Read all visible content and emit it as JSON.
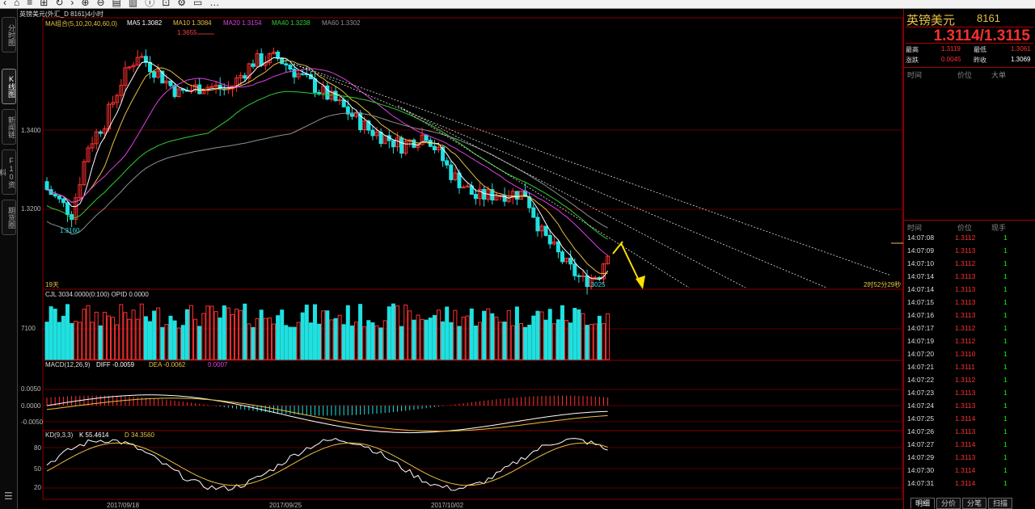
{
  "toolbar": {
    "icons": [
      "back-icon",
      "home-icon",
      "list-icon",
      "grid-icon",
      "refresh-icon",
      "forward-icon",
      "zoom-in-icon",
      "zoom-out-icon",
      "chart-icon",
      "bar-icon",
      "info-icon",
      "lock-icon",
      "tools-icon",
      "window-icon",
      "more-icon"
    ],
    "icon_glyphs": [
      "‹",
      "⌂",
      "≡",
      "⊞",
      "↻",
      "›",
      "⊕",
      "⊖",
      "▤",
      "▥",
      "ⓘ",
      "⊡",
      "⚙",
      "▭",
      "…"
    ],
    "right_items": [
      "",
      "",
      "",
      "",
      ""
    ]
  },
  "left_tabs": [
    {
      "label": "分时图"
    },
    {
      "label": "K线图"
    },
    {
      "label": "新闻链"
    },
    {
      "label": "F10资料"
    },
    {
      "label": "期货圈"
    }
  ],
  "chart": {
    "title": "英镑美元(外汇_D 8161)4小时",
    "ma_legend": [
      {
        "label": "MA组合(5,10,20,40,60,0)",
        "color": "#e8c040"
      },
      {
        "label": "MA5 1.3082",
        "color": "#ffffff"
      },
      {
        "label": "MA10 1.3084",
        "color": "#e8c040"
      },
      {
        "label": "MA20 1.3154",
        "color": "#e040e0"
      },
      {
        "label": "MA40 1.3238",
        "color": "#30d030"
      },
      {
        "label": "MA60 1.3302",
        "color": "#909090"
      }
    ],
    "high_marker": "1.3655",
    "low_marker_left": "1.3160",
    "low_marker_right": "1.3025",
    "bars_label": "19天",
    "countdown": "2时52分29秒",
    "price_axis": [
      "1.3400",
      "1.3200"
    ],
    "volume": {
      "label": "CJL  3034.0000(0:100)   OPID  0.0000",
      "axis": "7100"
    },
    "macd": {
      "label": "MACD(12,26,9)",
      "diff": "DIFF  -0.0059",
      "dea": "DEA  -0.0062",
      "macd": "0.0007",
      "axis": [
        "0.0050",
        "0.0000",
        "-0.0050"
      ]
    },
    "kd": {
      "label": "KD(9,3,3)",
      "k": "K  55.4614",
      "d": "D  34.3560",
      "axis": [
        "80",
        "50",
        "20"
      ]
    },
    "dates": [
      "2017/09/18",
      "2017/09/25",
      "2017/10/02"
    ]
  },
  "chart_data": {
    "type": "candlestick",
    "price_range": [
      1.302,
      1.37
    ],
    "colors": {
      "up": "#ff3030",
      "down": "#20e0e0",
      "ma5": "#ffffff",
      "ma10": "#e8c040",
      "ma20": "#e040e0",
      "ma40": "#30d030",
      "ma60": "#909090"
    }
  },
  "right_panel": {
    "name": "英镑美元",
    "code": "8161",
    "bid_ask": "1.3114/1.3115",
    "stats": [
      {
        "label": "最高",
        "value": "1.3119",
        "label2": "最低",
        "value2": "1.3061"
      },
      {
        "label": "涨跌",
        "value": "0.0045",
        "label2": "昨收",
        "value2": "1.3069"
      }
    ],
    "upper_header": {
      "time": "时间",
      "price": "价位",
      "vol": "大单"
    },
    "lower_header": {
      "time": "时间",
      "price": "价位",
      "vol": "现手"
    },
    "ticks": [
      {
        "time": "14:07:08",
        "price": "1.3112",
        "vol": "1"
      },
      {
        "time": "14:07:09",
        "price": "1.3113",
        "vol": "1"
      },
      {
        "time": "14:07:10",
        "price": "1.3112",
        "vol": "1"
      },
      {
        "time": "14:07:14",
        "price": "1.3113",
        "vol": "1"
      },
      {
        "time": "14:07:14",
        "price": "1.3113",
        "vol": "1"
      },
      {
        "time": "14:07:15",
        "price": "1.3113",
        "vol": "1"
      },
      {
        "time": "14:07:16",
        "price": "1.3113",
        "vol": "1"
      },
      {
        "time": "14:07:17",
        "price": "1.3112",
        "vol": "1"
      },
      {
        "time": "14:07:19",
        "price": "1.3112",
        "vol": "1"
      },
      {
        "time": "14:07:20",
        "price": "1.3110",
        "vol": "1"
      },
      {
        "time": "14:07:21",
        "price": "1.3111",
        "vol": "1"
      },
      {
        "time": "14:07:22",
        "price": "1.3112",
        "vol": "1"
      },
      {
        "time": "14:07:23",
        "price": "1.3113",
        "vol": "1"
      },
      {
        "time": "14:07:24",
        "price": "1.3113",
        "vol": "1"
      },
      {
        "time": "14:07:25",
        "price": "1.3114",
        "vol": "1"
      },
      {
        "time": "14:07:26",
        "price": "1.3113",
        "vol": "1"
      },
      {
        "time": "14:07:27",
        "price": "1.3114",
        "vol": "1"
      },
      {
        "time": "14:07:29",
        "price": "1.3113",
        "vol": "1"
      },
      {
        "time": "14:07:30",
        "price": "1.3114",
        "vol": "1"
      },
      {
        "time": "14:07:31",
        "price": "1.3114",
        "vol": "1"
      }
    ],
    "bottom_tabs": [
      "明细",
      "分价",
      "分笔",
      "扫描"
    ]
  }
}
